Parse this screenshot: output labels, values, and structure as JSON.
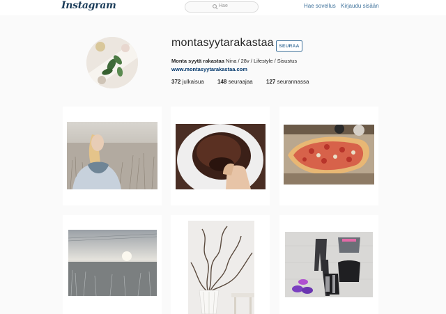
{
  "header": {
    "logo": "Instagram",
    "search_placeholder": "Hae",
    "get_app": "Hae sovellus",
    "login": "Kirjaudu sisään"
  },
  "profile": {
    "username": "montasyytarakastaa",
    "follow_label": "SEURAA",
    "full_name": "Monta syytä rakastaa",
    "bio": " Nina / 28v / Lifestyle / Sisustus",
    "website": "www.montasyytarakastaa.com",
    "stats": {
      "posts_count": "372",
      "posts_label": " julkaisua",
      "followers_count": "148",
      "followers_label": " seuraajaa",
      "following_count": "127",
      "following_label": " seurannassa"
    }
  },
  "posts": [
    {
      "subject": "woman-in-frosty-field-photo"
    },
    {
      "subject": "chocolate-cake-plate-photo"
    },
    {
      "subject": "pizza-on-table-photo"
    },
    {
      "subject": "misty-sunrise-landscape-photo"
    },
    {
      "subject": "curly-willow-vase-photo"
    },
    {
      "subject": "workout-clothes-flatlay-photo"
    }
  ]
}
